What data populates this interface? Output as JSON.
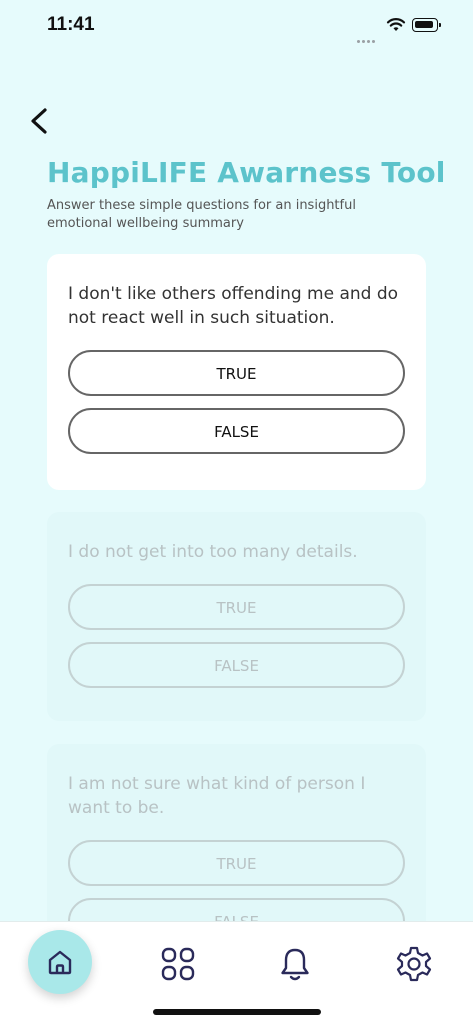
{
  "status_bar": {
    "time": "11:41"
  },
  "header": {
    "title": "HappiLIFE Awarness Tool",
    "subtitle": "Answer these simple questions for an insightful emotional wellbeing summary"
  },
  "questions": [
    {
      "text": "I don't like others offending me and do not react well in such situation.",
      "true_label": "TRUE",
      "false_label": "FALSE",
      "state": "active"
    },
    {
      "text": "I do not get into too many details.",
      "true_label": "TRUE",
      "false_label": "FALSE",
      "state": "inactive"
    },
    {
      "text": "I am not sure what kind of person I want to be.",
      "true_label": "TRUE",
      "false_label": "FALSE",
      "state": "inactive"
    }
  ],
  "nav": {
    "items": [
      {
        "icon": "home-icon",
        "active": true
      },
      {
        "icon": "grid-icon",
        "active": false
      },
      {
        "icon": "bell-icon",
        "active": false
      },
      {
        "icon": "gear-icon",
        "active": false
      }
    ]
  },
  "colors": {
    "accent": "#5cc3cb",
    "background": "#e6fbfc",
    "nav_icon": "#2a2a5a",
    "home_active": "#a9e8e9"
  }
}
